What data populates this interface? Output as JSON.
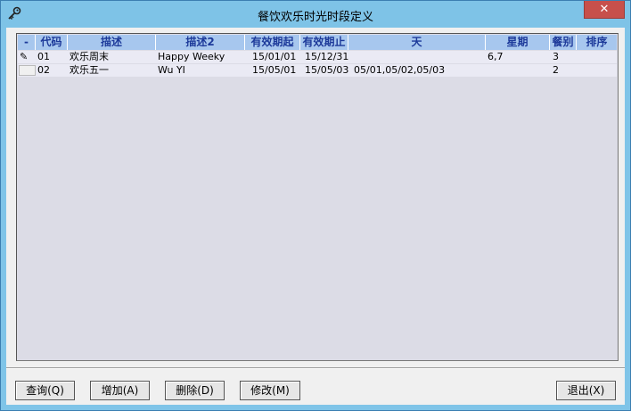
{
  "window": {
    "title": "餐饮欢乐时光时段定义",
    "close_label": "✕"
  },
  "grid": {
    "columns": [
      {
        "key": "sel",
        "label": "-"
      },
      {
        "key": "code",
        "label": "代码"
      },
      {
        "key": "desc",
        "label": "描述"
      },
      {
        "key": "desc2",
        "label": "描述2"
      },
      {
        "key": "start",
        "label": "有效期起"
      },
      {
        "key": "end",
        "label": "有效期止"
      },
      {
        "key": "day",
        "label": "天"
      },
      {
        "key": "week",
        "label": "星期"
      },
      {
        "key": "meal",
        "label": "餐别"
      },
      {
        "key": "sort",
        "label": "排序"
      }
    ],
    "rows": [
      {
        "code": "01",
        "desc": "欢乐周末",
        "desc2": "Happy Weeky",
        "start": "15/01/01",
        "end": "15/12/31",
        "day": "",
        "week": "6,7",
        "meal": "3",
        "sort": ""
      },
      {
        "code": "02",
        "desc": "欢乐五一",
        "desc2": "Wu YI",
        "start": "15/05/01",
        "end": "15/05/03",
        "day": "05/01,05/02,05/03",
        "week": "",
        "meal": "2",
        "sort": ""
      }
    ]
  },
  "buttons": {
    "query": "查询(Q)",
    "add": "增加(A)",
    "delete": "删除(D)",
    "modify": "修改(M)",
    "exit": "退出(X)"
  }
}
